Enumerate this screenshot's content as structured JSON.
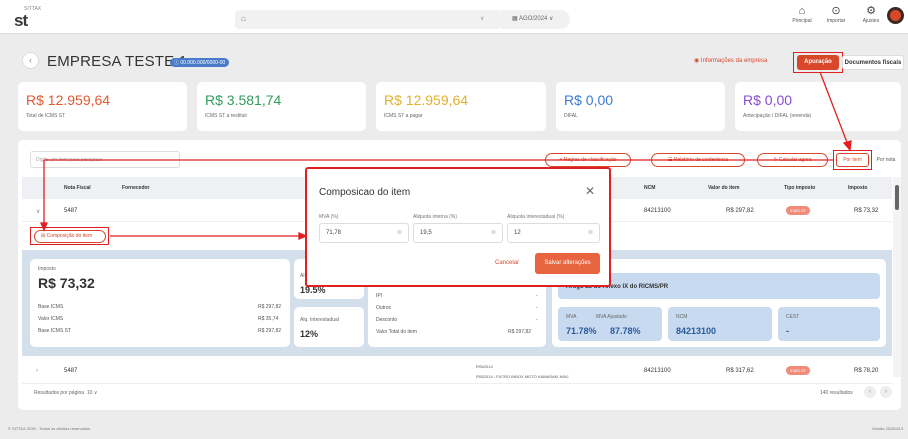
{
  "header": {
    "logo_sup": "SITTAX",
    "logo": "st",
    "company_select": "",
    "period": "AGO/2024",
    "nav": [
      {
        "label": "Principal",
        "icon": "home-icon"
      },
      {
        "label": "Importar",
        "icon": "upload-icon"
      },
      {
        "label": "Ajustes",
        "icon": "gear-icon"
      }
    ]
  },
  "page": {
    "title": "EMPRESA TESTE 1",
    "cnpj": "00.000.000/0000-00",
    "info": "Informações da empresa",
    "apuracao": "Apuração",
    "docs": "Documentos fiscais"
  },
  "cards": [
    {
      "value": "R$ 12.959,64",
      "label": "Total de ICMS ST",
      "color": "#e05a33"
    },
    {
      "value": "R$ 3.581,74",
      "label": "ICMS ST a restituir",
      "color": "#2e9e5a"
    },
    {
      "value": "R$ 12.959,64",
      "label": "ICMS ST a pagar",
      "color": "#e0b030"
    },
    {
      "value": "R$ 0,00",
      "label": "DIFAL",
      "color": "#3a7bd5"
    },
    {
      "value": "R$ 0,00",
      "label": "Antecipação / DIFAL (revenda)",
      "color": "#8a4bd0"
    }
  ],
  "toolbar": {
    "search_placeholder": "Digite um item para pesquisar",
    "regras": "Regras de classificação",
    "relatorio": "Relatório de conferência",
    "calcular": "Calcular agora",
    "por_item": "Por item",
    "por_nota": "Por nota"
  },
  "table": {
    "headers": [
      "Nota Fiscal",
      "Fornecedor",
      "NCM",
      "Valor do item",
      "Tipo imposto",
      "Imposto"
    ],
    "row1": {
      "nf": "5487",
      "ncm": "84213100",
      "valor": "R$ 297,82",
      "tipo": "ICMS ST",
      "imposto": "R$ 73,32"
    },
    "row2": {
      "nf": "5487",
      "desc_code": "RS62014",
      "desc": "RS62014 - FILTRO INBOX MOTO KAWASAKI NINJ",
      "ncm": "84213100",
      "valor": "R$ 317,62",
      "tipo": "ICMS ST",
      "imposto": "R$ 78,20"
    }
  },
  "composicao": "Composição do item",
  "detail": {
    "imposto_label": "Imposto",
    "imposto_value": "R$ 73,32",
    "left_rows": [
      {
        "k": "Base ICMS",
        "v": "R$ 297,82"
      },
      {
        "k": "Valor ICMS",
        "v": "R$ 35,74"
      },
      {
        "k": "Base ICMS ST",
        "v": "R$ 297,82"
      }
    ],
    "aliq_label": "Alíq",
    "aliq_value": "19.5%",
    "aliq_inter_label": "Alq. Interestadual",
    "aliq_inter_value": "12%",
    "mid_rows": [
      {
        "k": "IPI",
        "v": "-"
      },
      {
        "k": "Outros",
        "v": "-"
      },
      {
        "k": "Desconto",
        "v": "-"
      },
      {
        "k": "Valor Total do item",
        "v": "R$ 297,82"
      }
    ],
    "artigo": "Artigo 28 do Anexo IX do RICMS/PR",
    "mva_label": "MVA",
    "mva_value": "71.78%",
    "mva_aj_label": "MVA Ajustado",
    "mva_aj_value": "87.78%",
    "ncm_label": "NCM",
    "ncm_value": "84213100",
    "cest_label": "CEST",
    "cest_value": "-"
  },
  "footer": {
    "per_page": "Resultados por página",
    "per_page_value": "10",
    "results": "140 resultados",
    "copyright": "© SITTAX 2026 - Todos os direitos reservados",
    "version": "Versão 20260113"
  },
  "modal": {
    "title": "Composicao do item",
    "fields": [
      {
        "label": "MVA (%)",
        "value": "71,78"
      },
      {
        "label": "Aliquota interna (%)",
        "value": "19,5"
      },
      {
        "label": "Aliquota interestadual (%)",
        "value": "12"
      }
    ],
    "cancel": "Cancelar",
    "save": "Salvar alterações"
  }
}
